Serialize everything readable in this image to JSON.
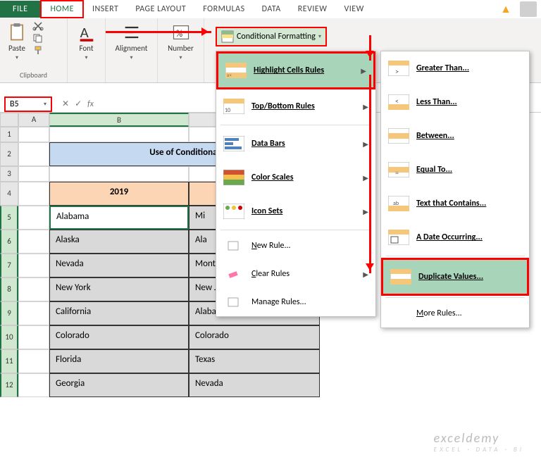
{
  "tabs": {
    "file": "FILE",
    "home": "HOME",
    "insert": "INSERT",
    "page_layout": "PAGE LAYOUT",
    "formulas": "FORMULAS",
    "data": "DATA",
    "review": "REVIEW",
    "view": "VIEW"
  },
  "ribbon": {
    "paste": "Paste",
    "font": "Font",
    "alignment": "Alignment",
    "number": "Number",
    "clipboard_label": "Clipboard",
    "cond_fmt": "Conditional Formatting"
  },
  "name_box": "B5",
  "menu1": {
    "highlight": "Highlight Cells Rules",
    "topbottom": "Top/Bottom Rules",
    "databars": "Data Bars",
    "colorscales": "Color Scales",
    "iconsets": "Icon Sets",
    "newrule": "New Rule...",
    "clear": "Clear Rules",
    "manage": "Manage Rules..."
  },
  "menu2": {
    "greater": "Greater Than...",
    "less": "Less Than...",
    "between": "Between...",
    "equal": "Equal To...",
    "contains": "Text that Contains...",
    "date": "A Date Occurring...",
    "duplicate": "Duplicate Values...",
    "more": "More Rules..."
  },
  "title": "Use of Conditional",
  "header": {
    "col1": "2019"
  },
  "data": {
    "b": [
      "Alabama",
      "Alaska",
      "Nevada",
      "New York",
      "California",
      "Colorado",
      "Florida",
      "Georgia"
    ],
    "c": [
      "Mi",
      "Ala",
      "Montana",
      "New Jersey",
      "Alabama",
      "Colorado",
      "Texas",
      "Nevada"
    ]
  },
  "watermark": {
    "main": "exceldemy",
    "sub": "EXCEL · DATA · BI"
  }
}
